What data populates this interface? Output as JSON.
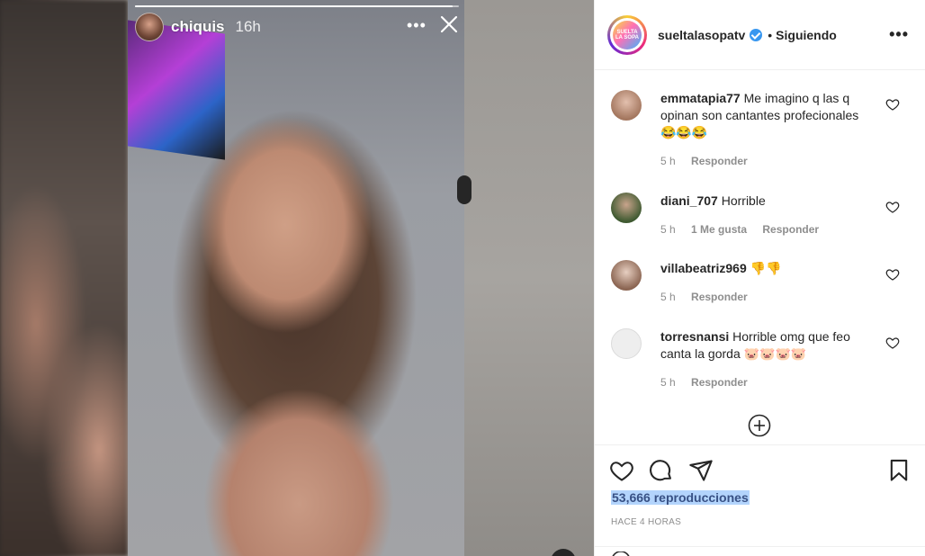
{
  "story": {
    "username": "chiquis",
    "time": "16h",
    "progress": 0.98
  },
  "post": {
    "account": "sueltalasopatv",
    "verified": true,
    "separator": "•",
    "follow_status": "Siguiendo",
    "more_icon": "•••",
    "logo_text": "SUELTA LA SOPA"
  },
  "comments": [
    {
      "user": "emmatapia77",
      "text": "Me imagino q las q opinan son cantantes profecionales 😂😂😂",
      "time": "5 h",
      "likes": "",
      "reply": "Responder",
      "avatar_color": "#c9a58f"
    },
    {
      "user": "diani_707",
      "text": "Horrible",
      "time": "5 h",
      "likes": "1 Me gusta",
      "reply": "Responder",
      "avatar_color": "#4f6b3c"
    },
    {
      "user": "villabeatriz969",
      "text": "👎👎",
      "time": "5 h",
      "likes": "",
      "reply": "Responder",
      "avatar_color": "#d0b6a6"
    },
    {
      "user": "torresnansi",
      "text": "Horrible omg que feo canta la gorda 🐷🐷🐷🐷",
      "time": "5 h",
      "likes": "",
      "reply": "Responder",
      "avatar_color": "#e6e6e6"
    }
  ],
  "footer": {
    "views": "53,666 reproducciones",
    "posted": "HACE 4 HORAS"
  },
  "icons": [
    "heart-icon",
    "comment-icon",
    "share-icon",
    "bookmark-icon",
    "add-circle-icon",
    "close-icon",
    "more-icon"
  ]
}
